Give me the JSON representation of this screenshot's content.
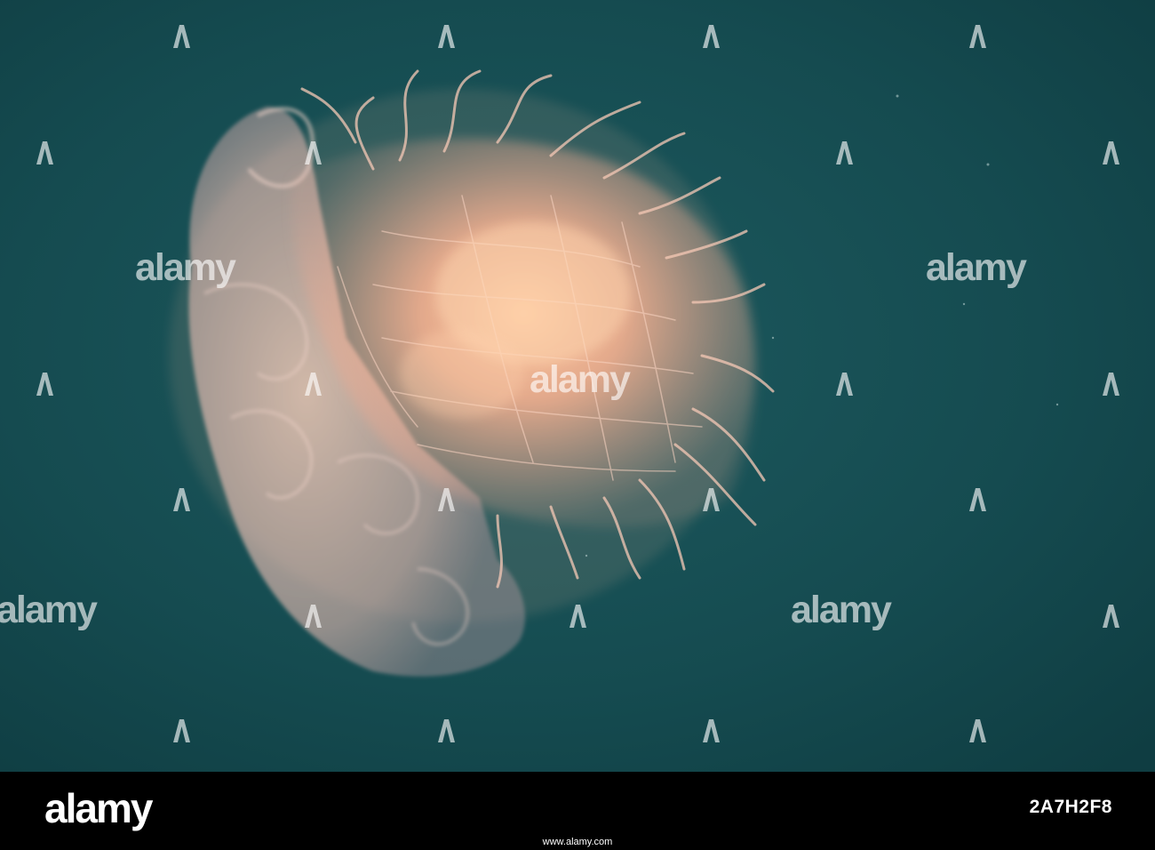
{
  "watermark": {
    "brand": "alamy",
    "mark_icon": "alamy-a-mark-icon"
  },
  "footer": {
    "brand": "alamy",
    "image_id": "2A7H2F8",
    "site": "www.alamy.com"
  },
  "colors": {
    "water": "#134a4f",
    "jellyfish_bell": "#f4c9b8",
    "jellyfish_glow": "#ffb98c"
  }
}
